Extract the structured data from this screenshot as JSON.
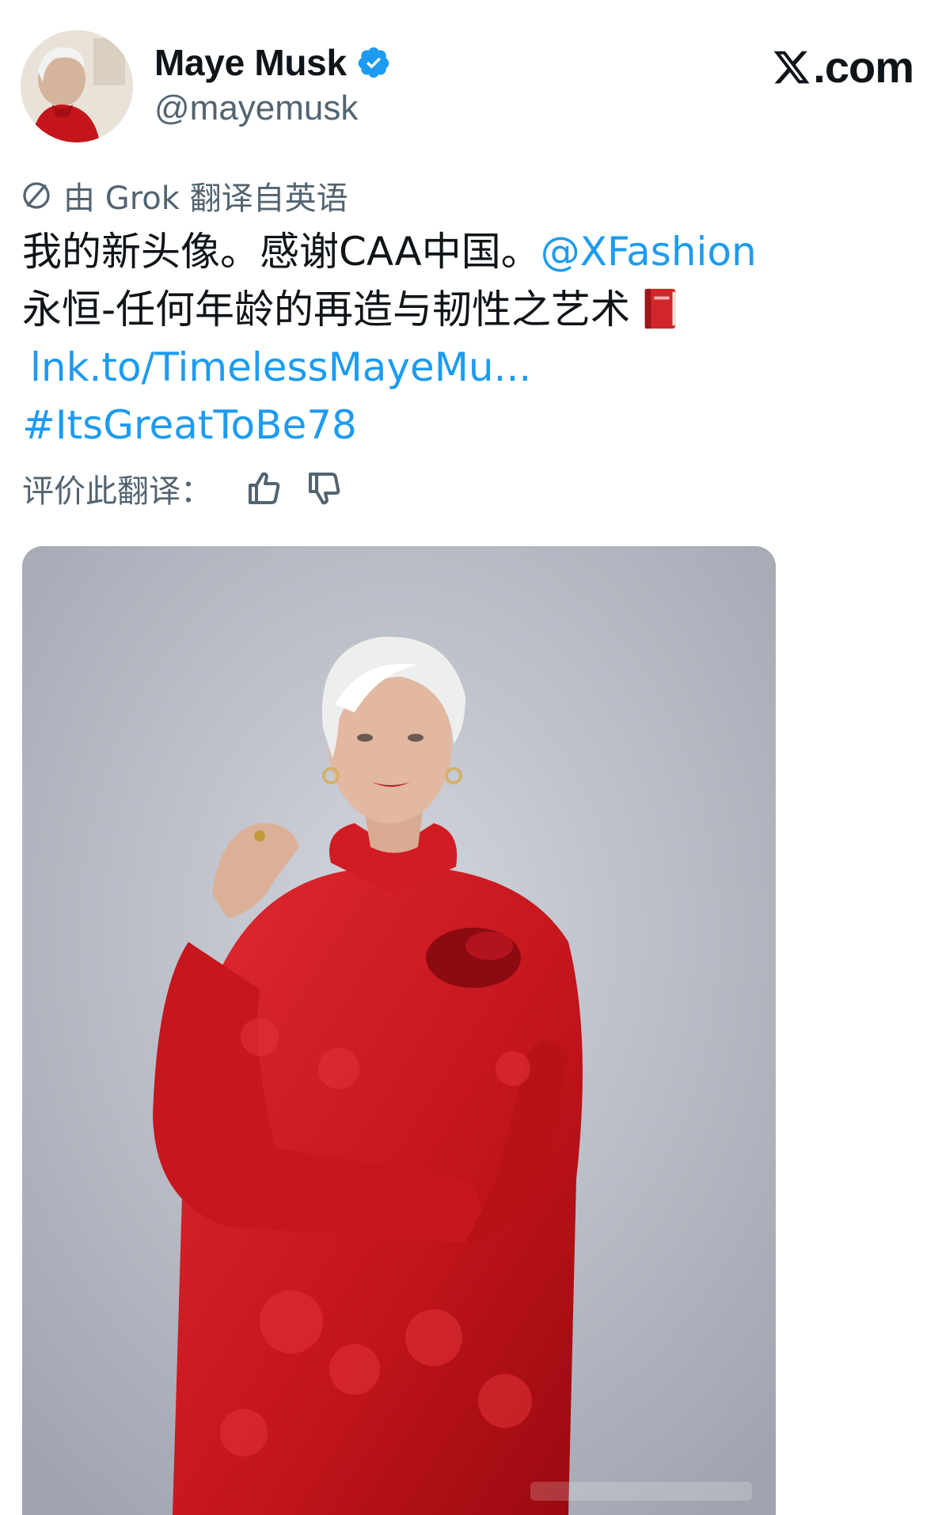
{
  "post": {
    "author": {
      "display_name": "Maye Musk",
      "handle": "@mayemusk",
      "verified": true,
      "avatar_icon": "profile-photo"
    },
    "site_logo": ".com",
    "site_logo_mark": "X",
    "translation": {
      "label": "由 Grok 翻译自英语",
      "icon": "translate-globe-icon"
    },
    "text_lines": {
      "line1_text": "我的新头像。感谢CAA中国。",
      "line1_mention": "@XFashion",
      "line2_text": "永恒-任何年龄的再造与韧性之艺术",
      "line2_emoji": "red-book-emoji",
      "line3_link": "lnk.to/TimelessMayeMu...",
      "line4_hashtag": "#ItsGreatToBe78"
    },
    "rate": {
      "label": "评价此翻译：",
      "thumbs_up_icon": "thumbs-up-icon",
      "thumbs_down_icon": "thumbs-down-icon"
    },
    "media": {
      "type": "photo",
      "subject": "portrait-red-jacket"
    },
    "colors": {
      "link": "#1d9bf0",
      "secondary_text": "#536471",
      "verified_badge": "#1d9bf0",
      "primary_text": "#0f1419"
    }
  }
}
